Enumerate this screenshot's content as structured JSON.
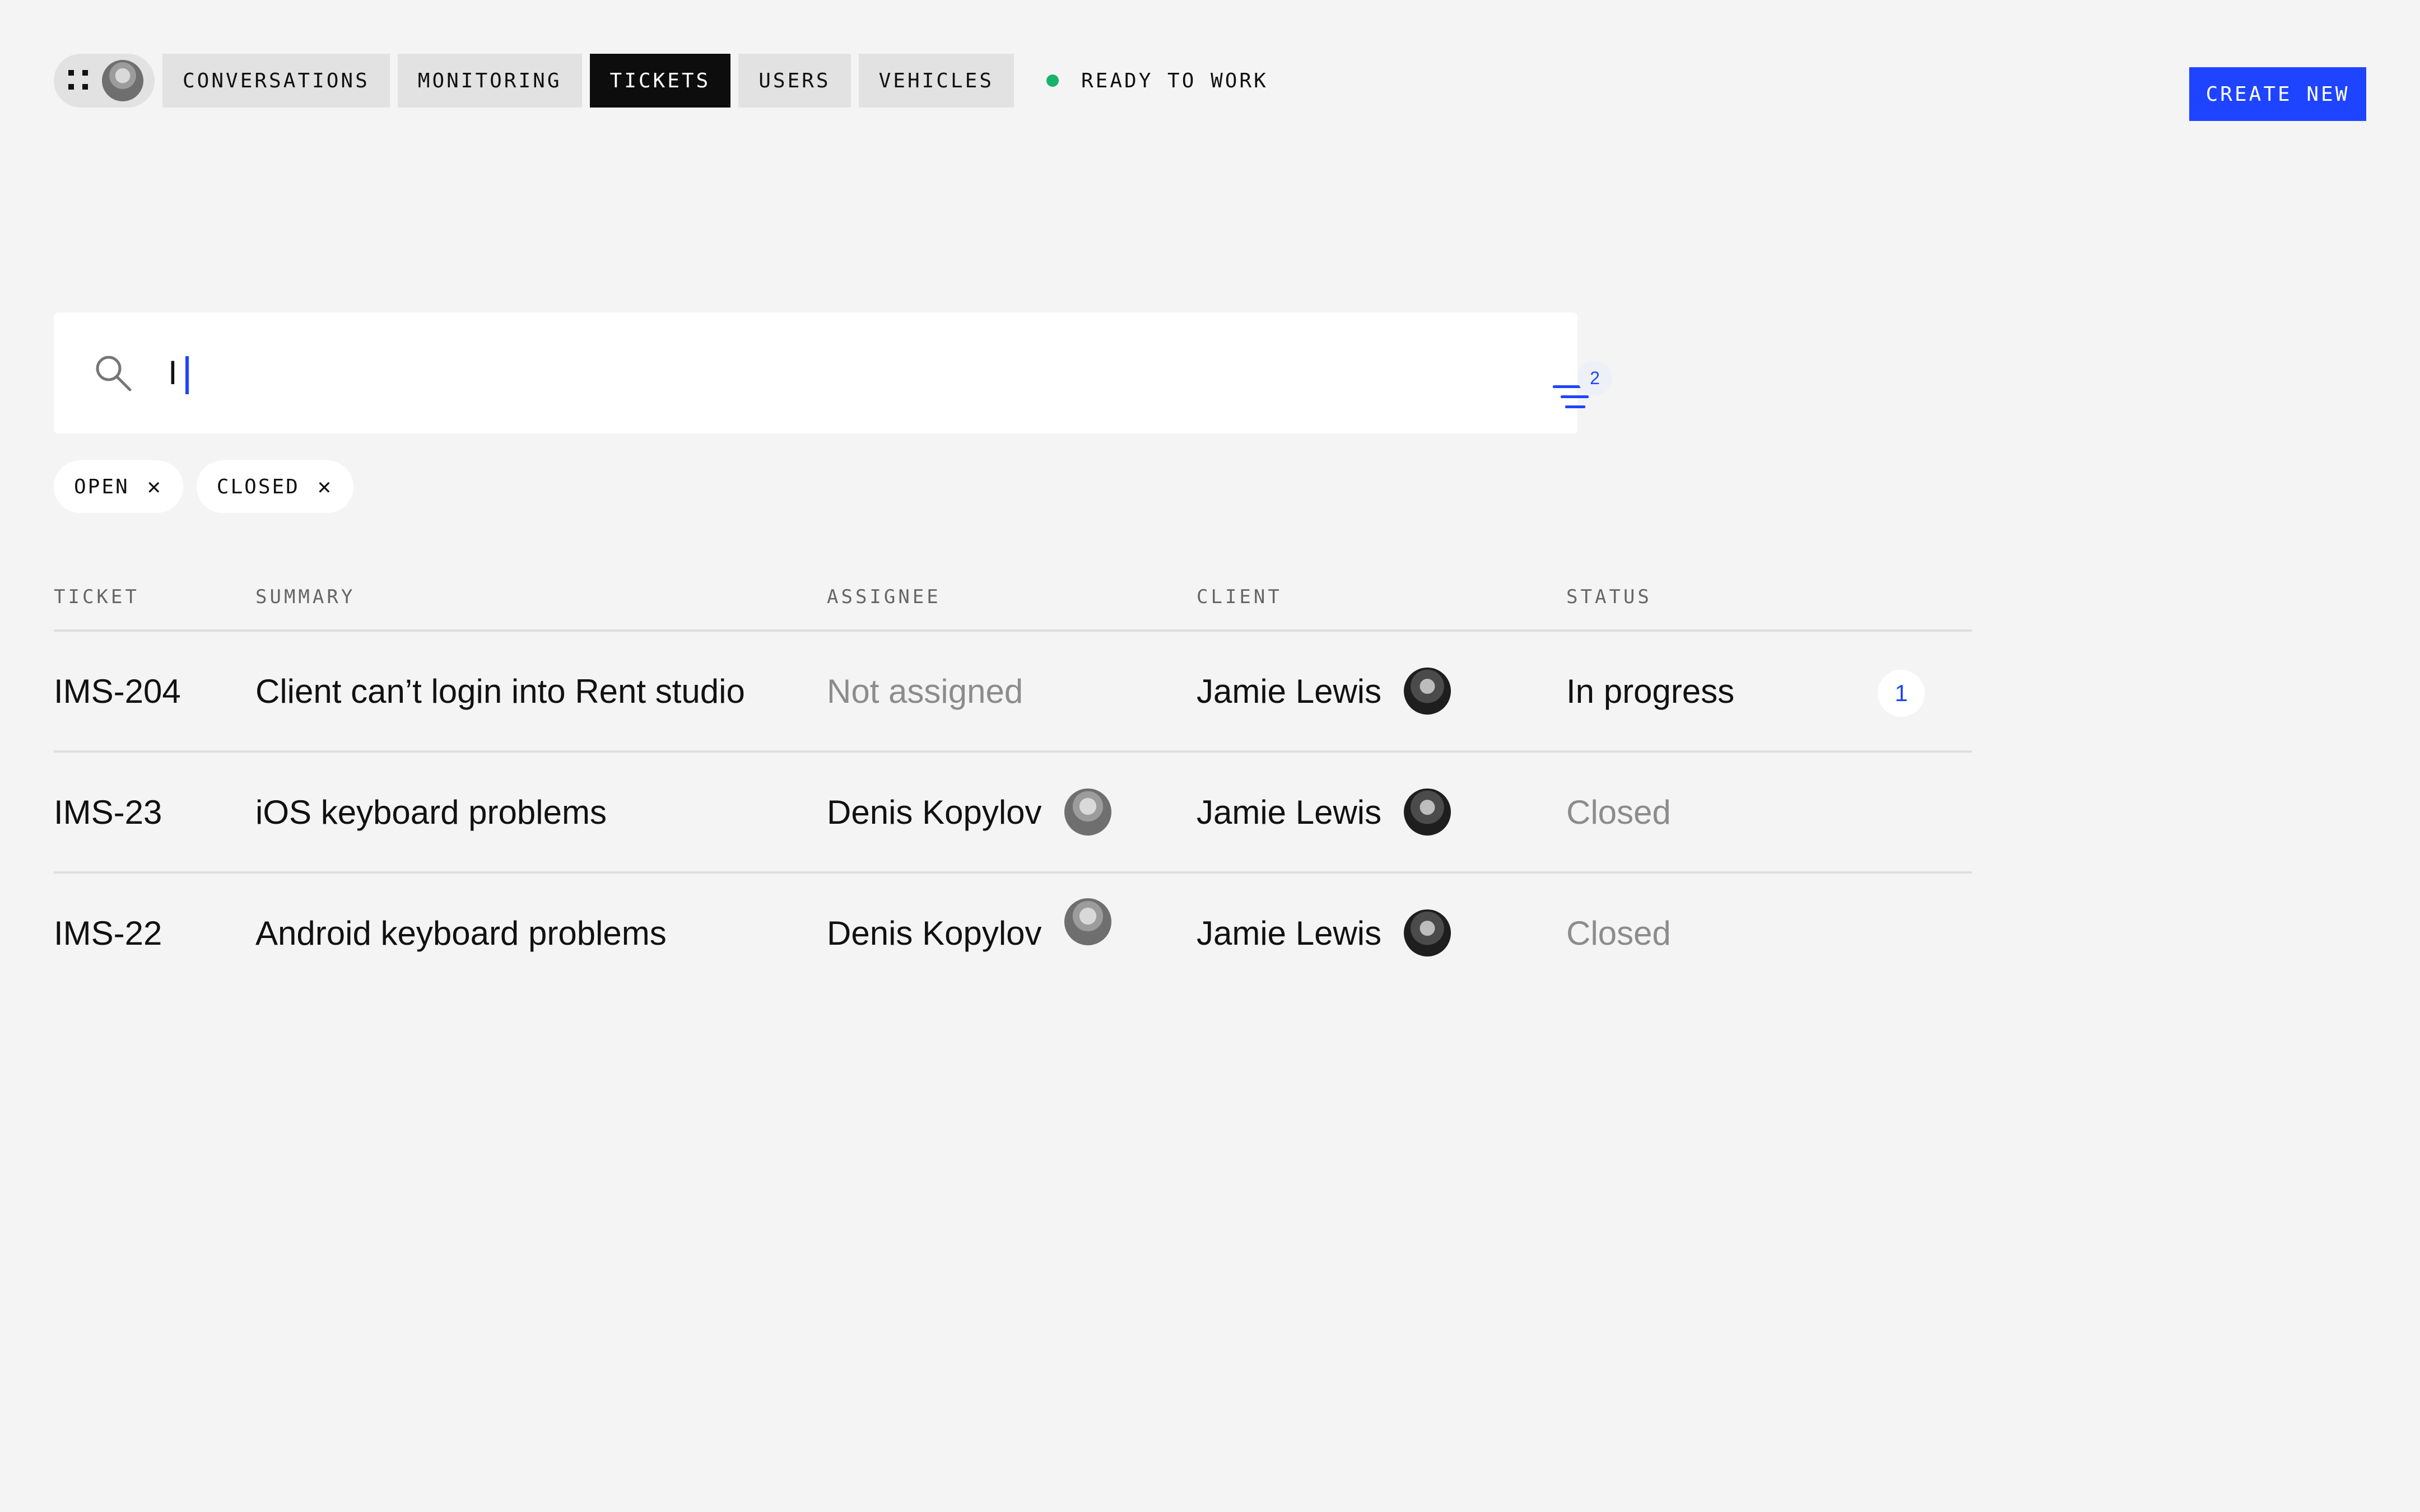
{
  "nav": {
    "tabs": [
      {
        "label": "CONVERSATIONS",
        "active": false
      },
      {
        "label": "MONITORING",
        "active": false
      },
      {
        "label": "TICKETS",
        "active": true
      },
      {
        "label": "USERS",
        "active": false
      },
      {
        "label": "VEHICLES",
        "active": false
      }
    ],
    "status_text": "READY TO WORK",
    "status_color": "#17b36b"
  },
  "create_button": {
    "label": "CREATE NEW",
    "color": "#1e44ff"
  },
  "search": {
    "value": "I",
    "filter_count": "2"
  },
  "chips": [
    {
      "label": "OPEN"
    },
    {
      "label": "CLOSED"
    }
  ],
  "table": {
    "columns": [
      "TICKET",
      "SUMMARY",
      "ASSIGNEE",
      "CLIENT",
      "STATUS"
    ],
    "rows": [
      {
        "ticket": "IMS-204",
        "summary": "Client can’t login into Rent studio",
        "assignee": "Not assigned",
        "client": "Jamie Lewis",
        "status": "In progress",
        "badge": "1"
      },
      {
        "ticket": "IMS-23",
        "summary": "iOS keyboard problems",
        "assignee": "Denis Kopylov",
        "client": "Jamie Lewis",
        "status": "Closed"
      },
      {
        "ticket": "IMS-22",
        "summary": "Android keyboard problems",
        "assignee": "Denis Kopylov",
        "client": "Jamie Lewis",
        "status": "Closed"
      }
    ]
  },
  "icons": [
    "menu-grid-icon",
    "user-avatar",
    "search-icon",
    "filter-icon",
    "close-icon"
  ]
}
